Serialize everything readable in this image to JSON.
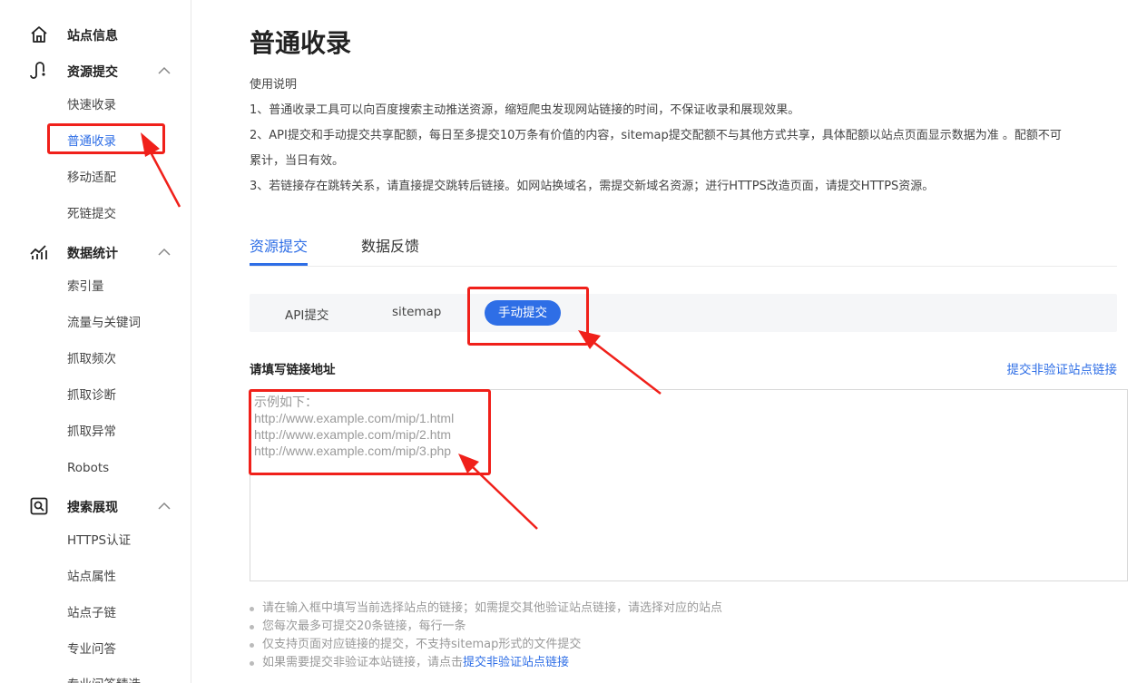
{
  "sidebar": {
    "groups": [
      {
        "label": "站点信息"
      },
      {
        "label": "资源提交"
      },
      {
        "label": "数据统计"
      },
      {
        "label": "搜索展现"
      }
    ],
    "resource_items": [
      "快速收录",
      "普通收录",
      "移动适配",
      "死链提交"
    ],
    "stats_items": [
      "索引量",
      "流量与关键词",
      "抓取频次",
      "抓取诊断",
      "抓取异常",
      "Robots"
    ],
    "search_items": [
      "HTTPS认证",
      "站点属性",
      "站点子链",
      "专业问答",
      "专业问答精选"
    ]
  },
  "main": {
    "title": "普通收录",
    "usage_title": "使用说明",
    "usage_lines": [
      "1、普通收录工具可以向百度搜索主动推送资源，缩短爬虫发现网站链接的时间，不保证收录和展现效果。",
      "2、API提交和手动提交共享配额，每日至多提交10万条有价值的内容，sitemap提交配额不与其他方式共享，具体配额以站点页面显示数据为准 。配额不可",
      "累计，当日有效。",
      "3、若链接存在跳转关系，请直接提交跳转后链接。如网站换域名，需提交新域名资源；进行HTTPS改造页面，请提交HTTPS资源。"
    ],
    "tabs": [
      "资源提交",
      "数据反馈"
    ],
    "subtabs": [
      "API提交",
      "sitemap",
      "手动提交"
    ],
    "field_label": "请填写链接地址",
    "field_link": "提交非验证站点链接",
    "textarea_placeholder": "示例如下：\nhttp://www.example.com/mip/1.html\nhttp://www.example.com/mip/2.htm\nhttp://www.example.com/mip/3.php",
    "notes": [
      "请在输入框中填写当前选择站点的链接；如需提交其他验证站点链接，请选择对应的站点",
      "您每次最多可提交20条链接，每行一条",
      "仅支持页面对应链接的提交，不支持sitemap形式的文件提交"
    ],
    "note_last_prefix": "如果需要提交非验证本站链接，请点击",
    "note_last_link": "提交非验证站点链接"
  },
  "colors": {
    "accent": "#2e6ee6",
    "annotation": "#f0201a"
  }
}
